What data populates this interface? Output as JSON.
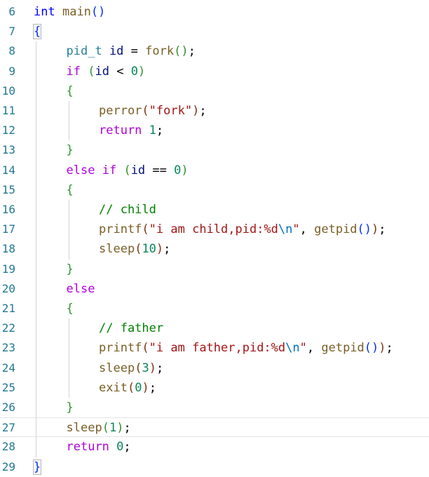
{
  "colors": {
    "background": "#ffffff",
    "line_number": "#237893",
    "keyword": "#0000ff",
    "control": "#af00db",
    "type": "#267f99",
    "variable": "#001080",
    "function": "#795e26",
    "string": "#a31515",
    "escape": "#0070c1",
    "number": "#098658",
    "comment": "#008000",
    "paren_level_1": "#0431fa",
    "paren_level_2": "#319331",
    "paren_level_3": "#7b3814",
    "indent_guide": "#d3d3d3",
    "current_line_border": "#e4e4e4"
  },
  "editor": {
    "language": "c",
    "current_line": 27,
    "lines": [
      {
        "number": "6",
        "indent": 0,
        "tokens": [
          {
            "t": "int",
            "k": "keyword"
          },
          {
            "t": " ",
            "k": "plain"
          },
          {
            "t": "main",
            "k": "function"
          },
          {
            "t": "()",
            "k": "paren1"
          }
        ]
      },
      {
        "number": "7",
        "indent": 0,
        "tokens": [
          {
            "t": "{",
            "k": "paren1",
            "match": true
          }
        ]
      },
      {
        "number": "8",
        "indent": 1,
        "tokens": [
          {
            "t": "pid_t",
            "k": "type"
          },
          {
            "t": " ",
            "k": "plain"
          },
          {
            "t": "id",
            "k": "variable"
          },
          {
            "t": " = ",
            "k": "operator"
          },
          {
            "t": "fork",
            "k": "function"
          },
          {
            "t": "()",
            "k": "paren2"
          },
          {
            "t": ";",
            "k": "plain"
          }
        ]
      },
      {
        "number": "9",
        "indent": 1,
        "tokens": [
          {
            "t": "if",
            "k": "control"
          },
          {
            "t": " ",
            "k": "plain"
          },
          {
            "t": "(",
            "k": "paren2"
          },
          {
            "t": "id",
            "k": "variable"
          },
          {
            "t": " < ",
            "k": "operator"
          },
          {
            "t": "0",
            "k": "number"
          },
          {
            "t": ")",
            "k": "paren2"
          }
        ]
      },
      {
        "number": "10",
        "indent": 1,
        "tokens": [
          {
            "t": "{",
            "k": "paren2"
          }
        ]
      },
      {
        "number": "11",
        "indent": 2,
        "tokens": [
          {
            "t": "perror",
            "k": "function"
          },
          {
            "t": "(",
            "k": "paren3"
          },
          {
            "t": "\"fork\"",
            "k": "string"
          },
          {
            "t": ")",
            "k": "paren3"
          },
          {
            "t": ";",
            "k": "plain"
          }
        ]
      },
      {
        "number": "12",
        "indent": 2,
        "tokens": [
          {
            "t": "return",
            "k": "control"
          },
          {
            "t": " ",
            "k": "plain"
          },
          {
            "t": "1",
            "k": "number"
          },
          {
            "t": ";",
            "k": "plain"
          }
        ]
      },
      {
        "number": "13",
        "indent": 1,
        "tokens": [
          {
            "t": "}",
            "k": "paren2"
          }
        ]
      },
      {
        "number": "14",
        "indent": 1,
        "tokens": [
          {
            "t": "else",
            "k": "control"
          },
          {
            "t": " ",
            "k": "plain"
          },
          {
            "t": "if",
            "k": "control"
          },
          {
            "t": " ",
            "k": "plain"
          },
          {
            "t": "(",
            "k": "paren2"
          },
          {
            "t": "id",
            "k": "variable"
          },
          {
            "t": " == ",
            "k": "operator"
          },
          {
            "t": "0",
            "k": "number"
          },
          {
            "t": ")",
            "k": "paren2"
          }
        ]
      },
      {
        "number": "15",
        "indent": 1,
        "tokens": [
          {
            "t": "{",
            "k": "paren2"
          }
        ]
      },
      {
        "number": "16",
        "indent": 2,
        "tokens": [
          {
            "t": "// child",
            "k": "comment"
          }
        ]
      },
      {
        "number": "17",
        "indent": 2,
        "tokens": [
          {
            "t": "printf",
            "k": "function"
          },
          {
            "t": "(",
            "k": "paren3"
          },
          {
            "t": "\"i am child,pid:%d",
            "k": "string"
          },
          {
            "t": "\\n",
            "k": "escape"
          },
          {
            "t": "\"",
            "k": "string"
          },
          {
            "t": ", ",
            "k": "plain"
          },
          {
            "t": "getpid",
            "k": "function"
          },
          {
            "t": "()",
            "k": "paren1"
          },
          {
            "t": ")",
            "k": "paren3"
          },
          {
            "t": ";",
            "k": "plain"
          }
        ]
      },
      {
        "number": "18",
        "indent": 2,
        "tokens": [
          {
            "t": "sleep",
            "k": "function"
          },
          {
            "t": "(",
            "k": "paren3"
          },
          {
            "t": "10",
            "k": "number"
          },
          {
            "t": ")",
            "k": "paren3"
          },
          {
            "t": ";",
            "k": "plain"
          }
        ]
      },
      {
        "number": "19",
        "indent": 1,
        "tokens": [
          {
            "t": "}",
            "k": "paren2"
          }
        ]
      },
      {
        "number": "20",
        "indent": 1,
        "tokens": [
          {
            "t": "else",
            "k": "control"
          }
        ]
      },
      {
        "number": "21",
        "indent": 1,
        "tokens": [
          {
            "t": "{",
            "k": "paren2"
          }
        ]
      },
      {
        "number": "22",
        "indent": 2,
        "tokens": [
          {
            "t": "// father",
            "k": "comment"
          }
        ]
      },
      {
        "number": "23",
        "indent": 2,
        "tokens": [
          {
            "t": "printf",
            "k": "function"
          },
          {
            "t": "(",
            "k": "paren3"
          },
          {
            "t": "\"i am father,pid:%d",
            "k": "string"
          },
          {
            "t": "\\n",
            "k": "escape"
          },
          {
            "t": "\"",
            "k": "string"
          },
          {
            "t": ", ",
            "k": "plain"
          },
          {
            "t": "getpid",
            "k": "function"
          },
          {
            "t": "()",
            "k": "paren1"
          },
          {
            "t": ")",
            "k": "paren3"
          },
          {
            "t": ";",
            "k": "plain"
          }
        ]
      },
      {
        "number": "24",
        "indent": 2,
        "tokens": [
          {
            "t": "sleep",
            "k": "function"
          },
          {
            "t": "(",
            "k": "paren3"
          },
          {
            "t": "3",
            "k": "number"
          },
          {
            "t": ")",
            "k": "paren3"
          },
          {
            "t": ";",
            "k": "plain"
          }
        ]
      },
      {
        "number": "25",
        "indent": 2,
        "tokens": [
          {
            "t": "exit",
            "k": "function"
          },
          {
            "t": "(",
            "k": "paren3"
          },
          {
            "t": "0",
            "k": "number"
          },
          {
            "t": ")",
            "k": "paren3"
          },
          {
            "t": ";",
            "k": "plain"
          }
        ]
      },
      {
        "number": "26",
        "indent": 1,
        "tokens": [
          {
            "t": "}",
            "k": "paren2"
          }
        ]
      },
      {
        "number": "27",
        "indent": 1,
        "tokens": [
          {
            "t": "sleep",
            "k": "function"
          },
          {
            "t": "(",
            "k": "paren2"
          },
          {
            "t": "1",
            "k": "number"
          },
          {
            "t": ")",
            "k": "paren2"
          },
          {
            "t": ";",
            "k": "plain"
          }
        ]
      },
      {
        "number": "28",
        "indent": 1,
        "tokens": [
          {
            "t": "return",
            "k": "control"
          },
          {
            "t": " ",
            "k": "plain"
          },
          {
            "t": "0",
            "k": "number"
          },
          {
            "t": ";",
            "k": "plain"
          }
        ]
      },
      {
        "number": "29",
        "indent": 0,
        "tokens": [
          {
            "t": "}",
            "k": "paren1",
            "match": true
          }
        ]
      }
    ]
  }
}
